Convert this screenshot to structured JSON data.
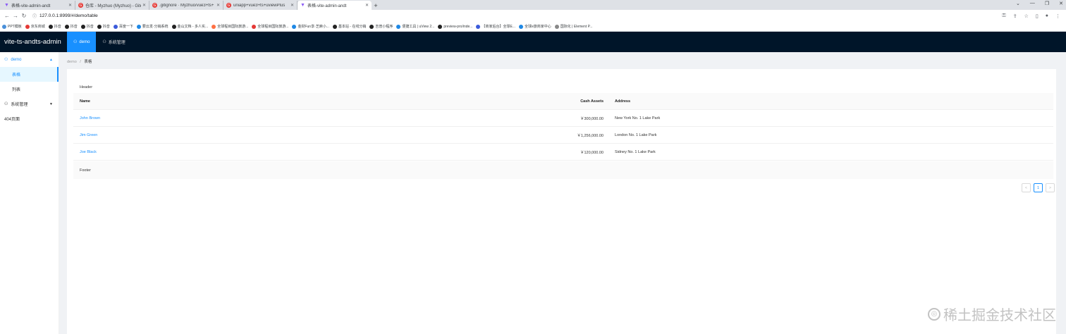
{
  "browser": {
    "tabs": [
      {
        "title": "表格-vite-admin-andt",
        "icon": "vite-icon"
      },
      {
        "title": "仓库 - Myzhuo (Myzhuo) - Gitee",
        "icon": "gitee-icon"
      },
      {
        "title": ".gitignore · Myzhuo/vue3+ts+",
        "icon": "gitee-icon"
      },
      {
        "title": "uniapp+vue3+ts+uviewPlus",
        "icon": "gitee-icon"
      },
      {
        "title": "表格-vite-admin-andt",
        "icon": "vite-icon",
        "active": true
      }
    ],
    "url": "127.0.0.1:8999/#/demo/table",
    "bookmarks": [
      "PPT模板",
      "京东商城",
      "抖音",
      "抖音",
      "抖音",
      "抖音",
      "百度一下",
      "要云发·分销系统",
      "金山文档 - 多人实...",
      "全球程目国际旅游...",
      "全球程目国际旅游...",
      "金财Fun享·芝麻小...",
      "基本站 - 在线分销",
      "吉普小程序",
      "便捷工具 | uView 2...",
      "preview-pro/inde...",
      "【商家后台】全球E...",
      "全球e旅商家中心",
      "国际化 | Element P..."
    ]
  },
  "app": {
    "title": "vite-ts-andts-admin",
    "top_menu": [
      {
        "label": "demo",
        "active": true
      },
      {
        "label": "系统管理",
        "active": false
      }
    ],
    "sidebar": {
      "groups": [
        {
          "label": "demo",
          "open": true,
          "items": [
            {
              "label": "表格",
              "active": true
            },
            {
              "label": "列表",
              "active": false
            }
          ]
        },
        {
          "label": "系统管理",
          "open": false,
          "items": []
        }
      ],
      "standalone": "404页面"
    },
    "breadcrumb": {
      "parent": "demo",
      "sep": "/",
      "current": "表格"
    },
    "table": {
      "header_text": "Header",
      "footer_text": "Footer",
      "columns": [
        "Name",
        "Cash Assets",
        "Address"
      ],
      "rows": [
        {
          "name": "John Brown",
          "cash": "￥300,000.00",
          "address": "New York No. 1 Lake Park"
        },
        {
          "name": "Jim Green",
          "cash": "￥1,256,000.00",
          "address": "London No. 1 Lake Park"
        },
        {
          "name": "Joe Black",
          "cash": "￥120,000.00",
          "address": "Sidney No. 1 Lake Park"
        }
      ]
    },
    "pagination": {
      "prev": "<",
      "page": "1",
      "next": ">"
    }
  },
  "watermark": "稀土掘金技术社区"
}
